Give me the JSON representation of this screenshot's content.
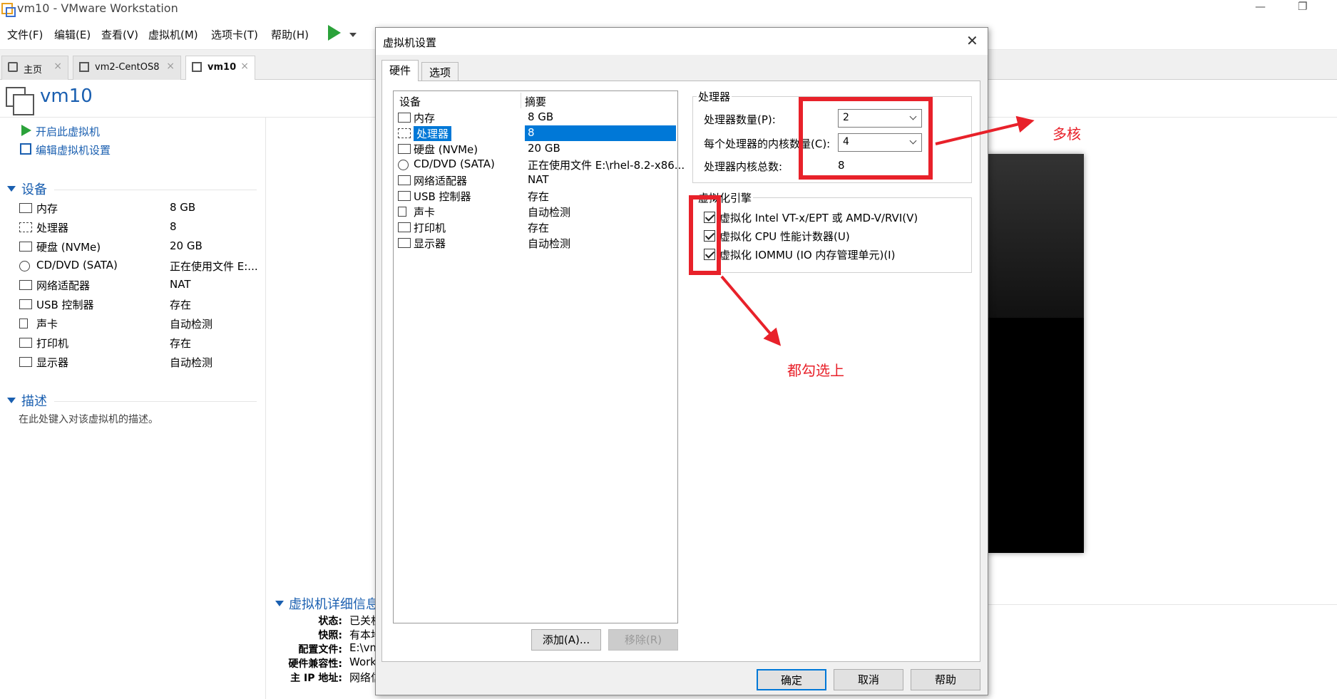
{
  "window": {
    "title": "vm10 - VMware Workstation",
    "minimize": "—",
    "restore": "❐"
  },
  "menu": [
    "文件(F)",
    "编辑(E)",
    "查看(V)",
    "虚拟机(M)",
    "选项卡(T)",
    "帮助(H)"
  ],
  "tabs": [
    {
      "label": "主页",
      "close": "×"
    },
    {
      "label": "vm2-CentOS8",
      "close": "×"
    },
    {
      "label": "vm10",
      "close": "×"
    }
  ],
  "vm": {
    "name": "vm10"
  },
  "actions": {
    "power_on": "开启此虚拟机",
    "edit_settings": "编辑虚拟机设置"
  },
  "devices_section": {
    "title": "设备"
  },
  "devices": [
    {
      "name": "内存",
      "value": "8 GB"
    },
    {
      "name": "处理器",
      "value": "8"
    },
    {
      "name": "硬盘 (NVMe)",
      "value": "20 GB"
    },
    {
      "name": "CD/DVD (SATA)",
      "value": "正在使用文件 E:..."
    },
    {
      "name": "网络适配器",
      "value": "NAT"
    },
    {
      "name": "USB 控制器",
      "value": "存在"
    },
    {
      "name": "声卡",
      "value": "自动检测"
    },
    {
      "name": "打印机",
      "value": "存在"
    },
    {
      "name": "显示器",
      "value": "自动检测"
    }
  ],
  "description_section": {
    "title": "描述",
    "placeholder": "在此处键入对该虚拟机的描述。"
  },
  "details_section": {
    "title": "虚拟机详细信息",
    "rows": [
      {
        "label": "状态:",
        "value": "已关机"
      },
      {
        "label": "快照:",
        "value": "有本地"
      },
      {
        "label": "配置文件:",
        "value": "E:\\vm"
      },
      {
        "label": "硬件兼容性:",
        "value": "Work"
      },
      {
        "label": "主 IP 地址:",
        "value": "网络信"
      }
    ]
  },
  "dialog": {
    "title": "虚拟机设置",
    "close": "✕",
    "tabs": [
      "硬件",
      "选项"
    ],
    "list_headers": {
      "device": "设备",
      "summary": "摘要"
    },
    "hardware": [
      {
        "name": "内存",
        "value": "8 GB"
      },
      {
        "name": "处理器",
        "value": "8"
      },
      {
        "name": "硬盘 (NVMe)",
        "value": "20 GB"
      },
      {
        "name": "CD/DVD (SATA)",
        "value": "正在使用文件 E:\\rhel-8.2-x86..."
      },
      {
        "name": "网络适配器",
        "value": "NAT"
      },
      {
        "name": "USB 控制器",
        "value": "存在"
      },
      {
        "name": "声卡",
        "value": "自动检测"
      },
      {
        "name": "打印机",
        "value": "存在"
      },
      {
        "name": "显示器",
        "value": "自动检测"
      }
    ],
    "buttons": {
      "add": "添加(A)...",
      "remove": "移除(R)",
      "ok": "确定",
      "cancel": "取消",
      "help": "帮助"
    },
    "processor_group": {
      "title": "处理器",
      "count_label": "处理器数量(P):",
      "count_value": "2",
      "cores_label": "每个处理器的内核数量(C):",
      "cores_value": "4",
      "total_label": "处理器内核总数:",
      "total_value": "8"
    },
    "virt_group": {
      "title": "虚拟化引擎",
      "options": [
        {
          "label": "虚拟化 Intel VT-x/EPT 或 AMD-V/RVI(V)",
          "checked": true
        },
        {
          "label": "虚拟化 CPU 性能计数器(U)",
          "checked": true
        },
        {
          "label": "虚拟化 IOMMU (IO 内存管理单元)(I)",
          "checked": true
        }
      ]
    }
  },
  "annotations": {
    "multicore": "多核",
    "check_all": "都勾选上",
    "color": "#e8212a"
  }
}
